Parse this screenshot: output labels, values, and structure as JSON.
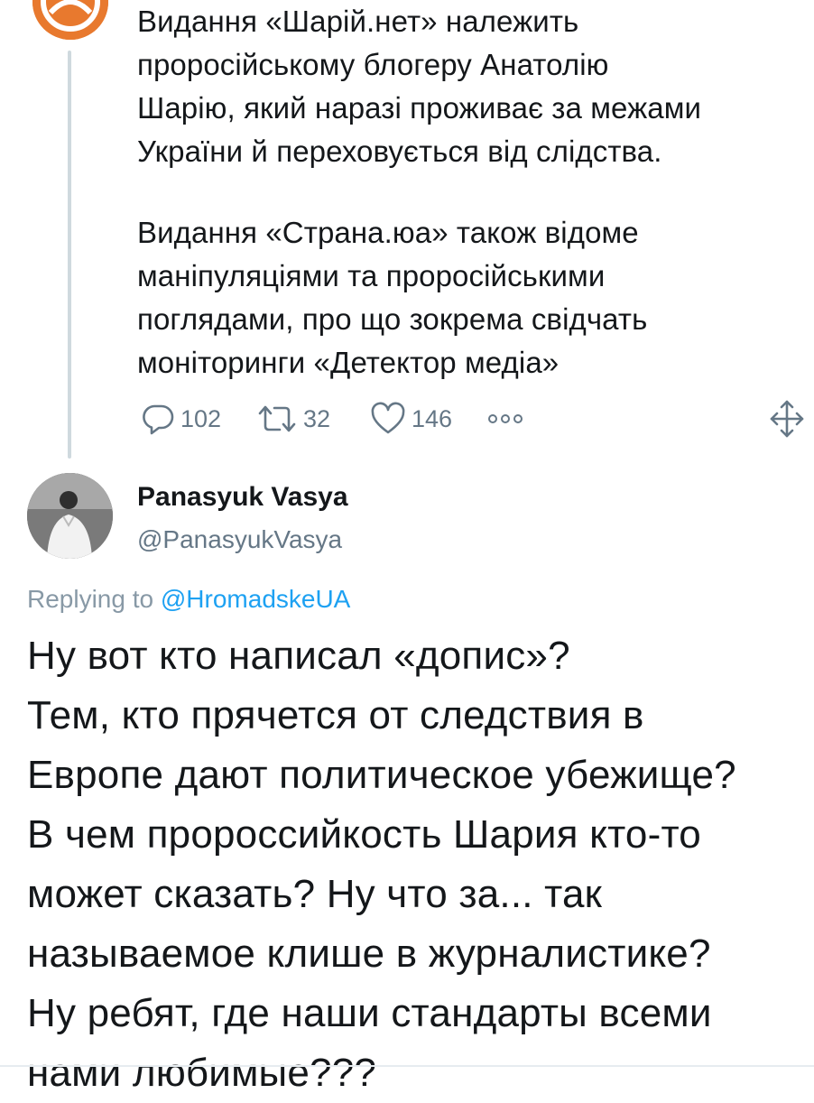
{
  "parent_tweet": {
    "paragraphs": [
      "Видання «Шарій.нет» належить\nпроросійському блогеру Анатолію\nШарію, який наразі проживає за межами\nУкраїни й переховується від слідства.",
      "Видання «Страна.юа» також відоме\nманіпуляціями та проросійськими\nпоглядами, про що зокрема свідчать\nмоніторинги «Детектор медіа»"
    ],
    "actions": {
      "replies": "102",
      "retweets": "32",
      "likes": "146"
    }
  },
  "reply_tweet": {
    "author_name": "Panasyuk Vasya",
    "author_handle": "@PanasyukVasya",
    "replying_to_prefix": "Replying to ",
    "replying_to_handle": "@HromadskeUA",
    "body": "Ну вот кто написал «допис»?\nТем, кто прячется от следствия в\nЕвропе дают политическое убежище?\nВ чем пророссийкость Шария кто-то\nможет сказать? Ну что за... так\nназываемое клише в журналистике?\nНу ребят, где наши стандарты всеми\nнами любимые???"
  },
  "icons": {
    "reply": "reply-icon",
    "retweet": "retweet-icon",
    "like": "heart-icon",
    "more": "more-dots-icon",
    "expand": "expand-arrows-icon"
  },
  "colors": {
    "text": "#14171a",
    "secondary": "#657786",
    "link": "#1da1f2",
    "avatar_orange": "#e8792e"
  }
}
